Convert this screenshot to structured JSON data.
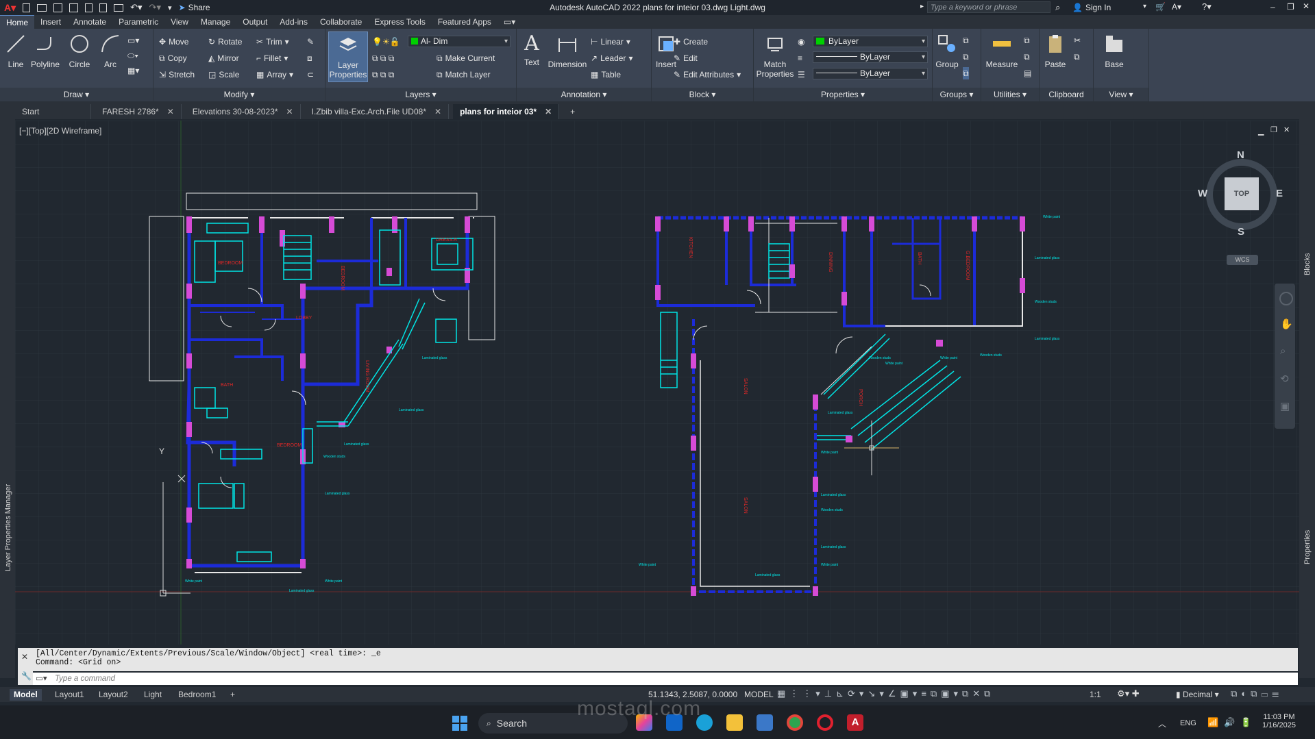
{
  "titlebar": {
    "app_title": "Autodesk AutoCAD 2022    plans for inteior 03.dwg Light.dwg",
    "share_label": "Share",
    "search_placeholder": "Type a keyword or phrase",
    "sign_in": "Sign In"
  },
  "ribbon_tabs": [
    "Home",
    "Insert",
    "Annotate",
    "Parametric",
    "View",
    "Manage",
    "Output",
    "Add-ins",
    "Collaborate",
    "Express Tools",
    "Featured Apps"
  ],
  "draw": {
    "title": "Draw ▾",
    "line": "Line",
    "polyline": "Polyline",
    "circle": "Circle",
    "arc": "Arc"
  },
  "modify": {
    "title": "Modify ▾",
    "move": "Move",
    "rotate": "Rotate",
    "trim": "Trim",
    "copy": "Copy",
    "mirror": "Mirror",
    "fillet": "Fillet",
    "stretch": "Stretch",
    "scale": "Scale",
    "array": "Array"
  },
  "layers": {
    "title": "Layers ▾",
    "layer_properties": "Layer Properties",
    "current_layer": "Al- Dim",
    "make_current": "Make Current",
    "match_layer": "Match Layer"
  },
  "annotation": {
    "title": "Annotation ▾",
    "text": "Text",
    "dimension": "Dimension",
    "linear": "Linear",
    "leader": "Leader",
    "table": "Table"
  },
  "block": {
    "title": "Block ▾",
    "insert": "Insert",
    "create": "Create",
    "edit": "Edit",
    "edit_attributes": "Edit Attributes"
  },
  "properties": {
    "title": "Properties ▾",
    "match_properties": "Match Properties",
    "color": "ByLayer",
    "linetype": "ByLayer",
    "lineweight": "ByLayer"
  },
  "groups": {
    "title": "Groups ▾",
    "group": "Group"
  },
  "utilities": {
    "title": "Utilities ▾",
    "measure": "Measure"
  },
  "clipboard": {
    "title": "Clipboard",
    "paste": "Paste"
  },
  "view": {
    "title": "View ▾",
    "base": "Base"
  },
  "doc_tabs": [
    "Start",
    "FARESH 2786*",
    "Elevations 30-08-2023*",
    "I.Zbib villa-Exc.Arch.File UD08*",
    "plans for inteior 03*"
  ],
  "viewport": {
    "label": "[−][Top][2D Wireframe]",
    "viewcube_top": "TOP",
    "compass": {
      "n": "N",
      "s": "S",
      "e": "E",
      "w": "W"
    },
    "wcs": "WCS"
  },
  "palettes": {
    "left": "Layer Properties Manager",
    "right_top": "Blocks",
    "right_bottom": "Properties"
  },
  "drawing": {
    "left_rooms": [
      "BEDROOM",
      "BEDROOM",
      "DRESS.R",
      "LOBBY",
      "LIVING ROOM",
      "BATH",
      "BEDROOM"
    ],
    "right_rooms": [
      "KITCHEN",
      "DINNING",
      "G.BEDROOM",
      "SALON",
      "SALON",
      "BATH",
      "PORCH"
    ],
    "leader_laminated": "Laminated glass",
    "leader_white_paint": "White paint",
    "leader_wooden": "Wooden studs"
  },
  "command": {
    "line1": "[All/Center/Dynamic/Extents/Previous/Scale/Window/Object] <real time>: _e",
    "line2": "Command:  <Grid on>",
    "placeholder": "Type a command"
  },
  "layout_tabs": [
    "Model",
    "Layout1",
    "Layout2",
    "Light",
    "Bedroom1"
  ],
  "status": {
    "coords": "51.1343, 2.5087, 0.0000",
    "model": "MODEL",
    "scale": "1:1",
    "units": "Decimal"
  },
  "taskbar": {
    "search": "Search",
    "lang": "ENG",
    "time": "11:03 PM",
    "date": "1/16/2025",
    "watermark": "mostaql.com"
  },
  "colors": {
    "accent": "#5b89c5",
    "wall": "#1c2bd8",
    "cyan": "#00e5e5",
    "magenta": "#d64bd6",
    "room_text": "#e02828"
  }
}
